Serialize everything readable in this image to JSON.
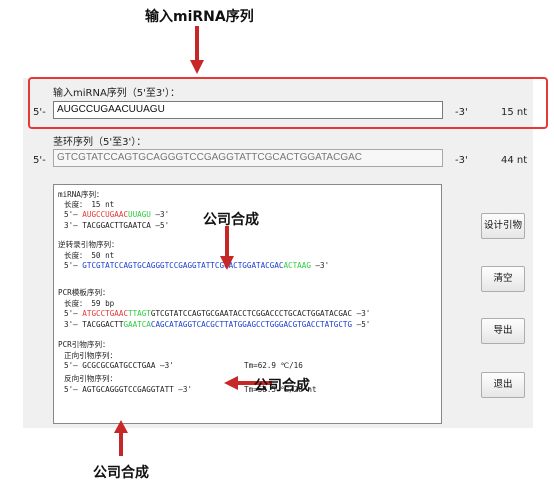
{
  "annotations": {
    "top": "输入miRNA序列",
    "mid": "公司合成",
    "right": "公司合成",
    "bottom": "公司合成"
  },
  "input_section": {
    "label": "输入miRNA序列（5'至3'）：",
    "prefix": "5'-",
    "value": "AUGCCUGAACUUAGU",
    "suffix": "-3'",
    "length": "15 nt"
  },
  "stemloop_section": {
    "label": "茎环序列（5'至3'）：",
    "prefix": "5'-",
    "value": "GTCGTATCCAGTGCAGGGTCCGAGGTATTCGCACTGGATACGAC",
    "suffix": "-3'",
    "length": "44 nt"
  },
  "output": {
    "mirna_header": "miRNA序列：",
    "mirna_len": "长度： 15 nt",
    "mirna_l1": {
      "pre": "5'— ",
      "red": "AUGCCUGAAC",
      "green": "UUAGU",
      "post": " —3'"
    },
    "mirna_l2": "3'— TACGGACTTGAATCA —5'",
    "rt_header": "逆转录引物序列：",
    "rt_len": "长度： 50 nt",
    "rt_l1": {
      "pre": "5'— ",
      "blue": "GTCGTATCCAGTGCAGGGTCCGAGGTATTCGCACTGGATACGAC",
      "green": "ACTAAG",
      "post": " —3'"
    },
    "pcr_header": "PCR模板序列：",
    "pcr_len": "长度： 59 bp",
    "pcr_l1": {
      "pre": "5'— ",
      "red": "ATGCCTGAAC",
      "green": "TTAGT",
      "rest": "GTCGTATCCAGTGCGAATACCTCGGACCCTGCACTGGATACGAC",
      "post": " —3'"
    },
    "pcr_l2": {
      "pre": "3'— TACGGACTT",
      "green": "GAATCA",
      "blue": "CAGCATAGGTCACGCTTATGGAGCCTGGGACGTGACCTATGCTG",
      "post": " —5'"
    },
    "primer_header": "PCR引物序列：",
    "fwd_header": "正向引物序列：",
    "fwd_seq": "5'— GCGCGCGATGCCTGAA —3'",
    "fwd_tm": "Tm=62.9 ℃/16",
    "rev_header": "反向引物序列：",
    "rev_seq": "5'— AGTGCAGGGTCCGAGGTATT —3'",
    "rev_tm": "Tm=58.5 ℃/20 nt"
  },
  "buttons": {
    "design": "设计引物",
    "clear": "清空",
    "export": "导出",
    "exit": "退出"
  },
  "colors": {
    "red": "#e53935",
    "green": "#2ecc40",
    "blue": "#1a3fd1",
    "highlight": "#e53935",
    "arrow": "#c62828"
  }
}
